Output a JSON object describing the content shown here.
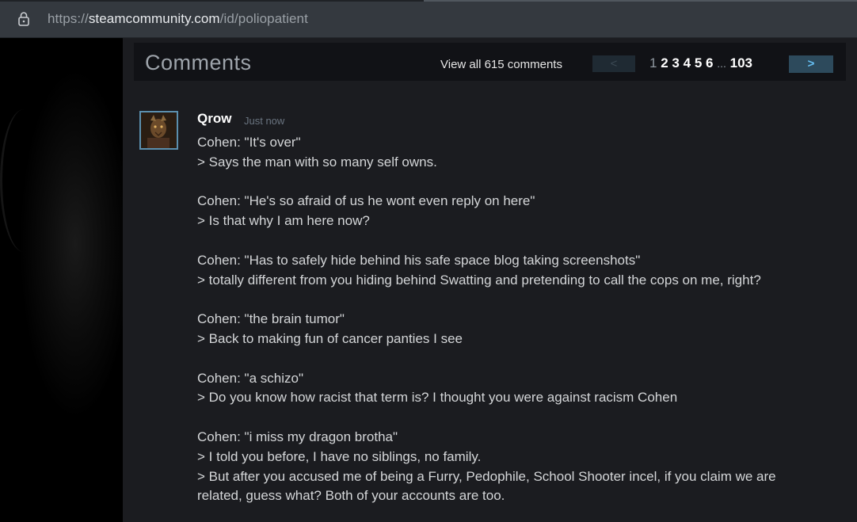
{
  "browser": {
    "url_scheme": "https://",
    "url_host": "steamcommunity.com",
    "url_path": "/id/poliopatient"
  },
  "comments_header": {
    "title": "Comments",
    "view_all": "View all 615 comments",
    "prev_label": "<",
    "next_label": ">",
    "pages": {
      "current": "1",
      "links": [
        "2",
        "3",
        "4",
        "5",
        "6"
      ],
      "ellipsis": "...",
      "last": "103"
    }
  },
  "comment": {
    "author": "Qrow",
    "timestamp": "Just now",
    "lines": [
      "Cohen: \"It's over\"",
      "> Says the man with so many self owns.",
      "",
      "Cohen: \"He's so afraid of us he wont even reply on here\"",
      "> Is that why I am here now?",
      "",
      "Cohen: \"Has to safely hide behind his safe space blog taking screenshots\"",
      "> totally different from you hiding behind Swatting and pretending to call the cops on me, right?",
      "",
      "Cohen: \"the brain tumor\"",
      "> Back to making fun of cancer panties I see",
      "",
      "Cohen: \"a schizo\"",
      "> Do you know how racist that term is? I thought you were against racism Cohen",
      "",
      "Cohen: \"i miss my dragon brotha\"",
      "> I told you before, I have no siblings, no family.",
      "> But after you accused me of being a Furry, Pedophile, School Shooter incel, if you claim we are",
      "related, guess what? Both of your accounts are too."
    ]
  },
  "colors": {
    "accent_next": "#66c0f4",
    "avatar_border": "#5b8fae",
    "content_bg": "#1b1c20"
  }
}
